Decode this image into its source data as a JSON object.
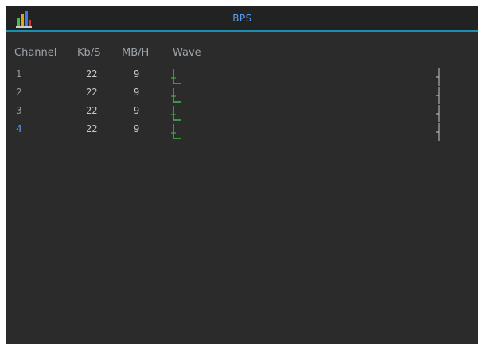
{
  "window": {
    "title": "BPS",
    "icon": "bar-chart-app-icon",
    "accent_color": "#1a8fb0",
    "title_color": "#5aa0f5"
  },
  "table": {
    "headers": {
      "channel": "Channel",
      "kbs": "Kb/S",
      "mbh": "MB/H",
      "wave": "Wave"
    },
    "rows": [
      {
        "channel": "1",
        "kbs": "22",
        "mbh": "9",
        "active": false
      },
      {
        "channel": "2",
        "kbs": "22",
        "mbh": "9",
        "active": false
      },
      {
        "channel": "3",
        "kbs": "22",
        "mbh": "9",
        "active": false
      },
      {
        "channel": "4",
        "kbs": "22",
        "mbh": "9",
        "active": true
      }
    ],
    "wave_color": "#3fbf3f",
    "active_channel_color": "#5aa0f5"
  }
}
